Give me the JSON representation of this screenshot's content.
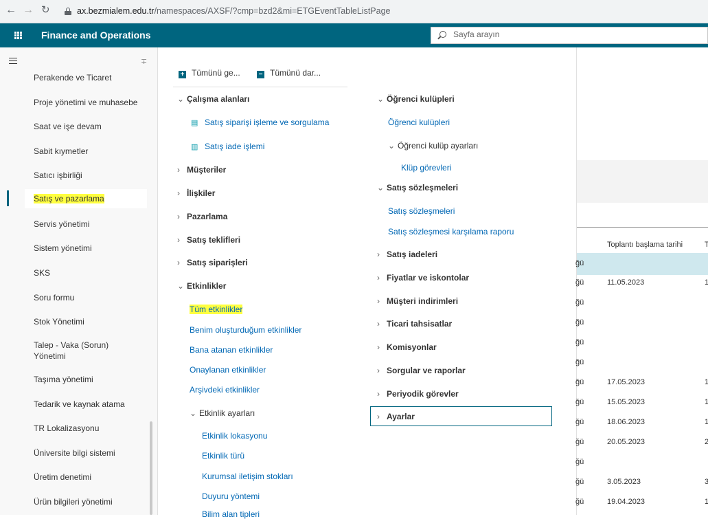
{
  "browser": {
    "url_host": "ax.bezmialem.edu.tr",
    "url_path": "/namespaces/AXSF/?cmp=bzd2&mi=ETGEventTableListPage"
  },
  "app": {
    "title": "Finance and Operations",
    "search_placeholder": "Sayfa arayın",
    "accent_color": "#00657f",
    "link_color": "#0067b4",
    "highlight_color": "#ffff40"
  },
  "sidebar": {
    "items": [
      {
        "label": "Perakende ve Ticaret"
      },
      {
        "label": "Proje yönetimi ve muhasebe"
      },
      {
        "label": "Saat ve işe devam"
      },
      {
        "label": "Sabit kıymetler"
      },
      {
        "label": "Satıcı işbirliği"
      },
      {
        "label": "Satış ve pazarlama",
        "active": true
      },
      {
        "label": "Servis yönetimi"
      },
      {
        "label": "Sistem yönetimi"
      },
      {
        "label": "SKS"
      },
      {
        "label": "Soru formu"
      },
      {
        "label": "Stok Yönetimi"
      },
      {
        "label": "Talep - Vaka (Sorun) Yönetimi"
      },
      {
        "label": "Taşıma yönetimi"
      },
      {
        "label": "Tedarik ve kaynak atama"
      },
      {
        "label": "TR Lokalizasyonu"
      },
      {
        "label": "Üniversite bilgi sistemi"
      },
      {
        "label": "Üretim denetimi"
      },
      {
        "label": "Ürün bilgileri yönetimi"
      }
    ]
  },
  "menu": {
    "expand_all": "Tümünü ge...",
    "collapse_all": "Tümünü dar...",
    "left": [
      {
        "label": "Çalışma alanları",
        "type": "group",
        "expanded": true
      },
      {
        "label": "Satış siparişi işleme ve sorgulama",
        "type": "workspace"
      },
      {
        "label": "Satış iade işlemi",
        "type": "workspace"
      },
      {
        "label": "Müşteriler",
        "type": "group"
      },
      {
        "label": "İlişkiler",
        "type": "group"
      },
      {
        "label": "Pazarlama",
        "type": "group"
      },
      {
        "label": "Satış teklifleri",
        "type": "group"
      },
      {
        "label": "Satış siparişleri",
        "type": "group"
      },
      {
        "label": "Etkinlikler",
        "type": "group",
        "expanded": true
      },
      {
        "label": "Tüm etkinlikler",
        "type": "link",
        "highlight": true
      },
      {
        "label": "Benim oluşturduğum etkinlikler",
        "type": "link"
      },
      {
        "label": "Bana atanan etkinlikler",
        "type": "link"
      },
      {
        "label": "Onaylanan etkinlikler",
        "type": "link"
      },
      {
        "label": "Arşivdeki etkinlikler",
        "type": "link"
      },
      {
        "label": "Etkinlik ayarları",
        "type": "subgroup",
        "expanded": true
      },
      {
        "label": "Etkinlik lokasyonu",
        "type": "link"
      },
      {
        "label": "Etkinlik türü",
        "type": "link"
      },
      {
        "label": "Kurumsal iletişim stokları",
        "type": "link"
      },
      {
        "label": "Duyuru yöntemi",
        "type": "link"
      },
      {
        "label": "Bilim alan tipleri",
        "type": "link"
      }
    ],
    "right": [
      {
        "label": "Öğrenci kulüpleri",
        "type": "group",
        "expanded": true
      },
      {
        "label": "Öğrenci kulüpleri",
        "type": "link"
      },
      {
        "label": "Öğrenci kulüp ayarları",
        "type": "subgroup",
        "expanded": true
      },
      {
        "label": "Klüp görevleri",
        "type": "link"
      },
      {
        "label": "Satış sözleşmeleri",
        "type": "group",
        "expanded": true
      },
      {
        "label": "Satış sözleşmeleri",
        "type": "link"
      },
      {
        "label": "Satış sözleşmesi karşılama raporu",
        "type": "link"
      },
      {
        "label": "Satış iadeleri",
        "type": "group"
      },
      {
        "label": "Fiyatlar ve iskontolar",
        "type": "group"
      },
      {
        "label": "Müşteri indirimleri",
        "type": "group"
      },
      {
        "label": "Ticari tahsisatlar",
        "type": "group"
      },
      {
        "label": "Komisyonlar",
        "type": "group"
      },
      {
        "label": "Sorgular ve raporlar",
        "type": "group"
      },
      {
        "label": "Periyodik görevler",
        "type": "group"
      },
      {
        "label": "Ayarlar",
        "type": "group",
        "focused": true
      }
    ]
  },
  "background_grid": {
    "column_header": "Toplantı başlama tarihi",
    "column_header2": "T",
    "rows": [
      {
        "c1": "ğü",
        "date": "",
        "c3": ""
      },
      {
        "c1": "ğü",
        "date": "11.05.2023",
        "c3": "1"
      },
      {
        "c1": "ğü",
        "date": "",
        "c3": ""
      },
      {
        "c1": "ğü",
        "date": "",
        "c3": ""
      },
      {
        "c1": "ğü",
        "date": "",
        "c3": ""
      },
      {
        "c1": "ğü",
        "date": "",
        "c3": ""
      },
      {
        "c1": "ğü",
        "date": "17.05.2023",
        "c3": "1"
      },
      {
        "c1": "ğü",
        "date": "15.05.2023",
        "c3": "1"
      },
      {
        "c1": "ğü",
        "date": "18.06.2023",
        "c3": "1"
      },
      {
        "c1": "ğü",
        "date": "20.05.2023",
        "c3": "2"
      },
      {
        "c1": "ğü",
        "date": "",
        "c3": ""
      },
      {
        "c1": "ğü",
        "date": "3.05.2023",
        "c3": "3"
      },
      {
        "c1": "ğü",
        "date": "19.04.2023",
        "c3": "1"
      }
    ]
  }
}
